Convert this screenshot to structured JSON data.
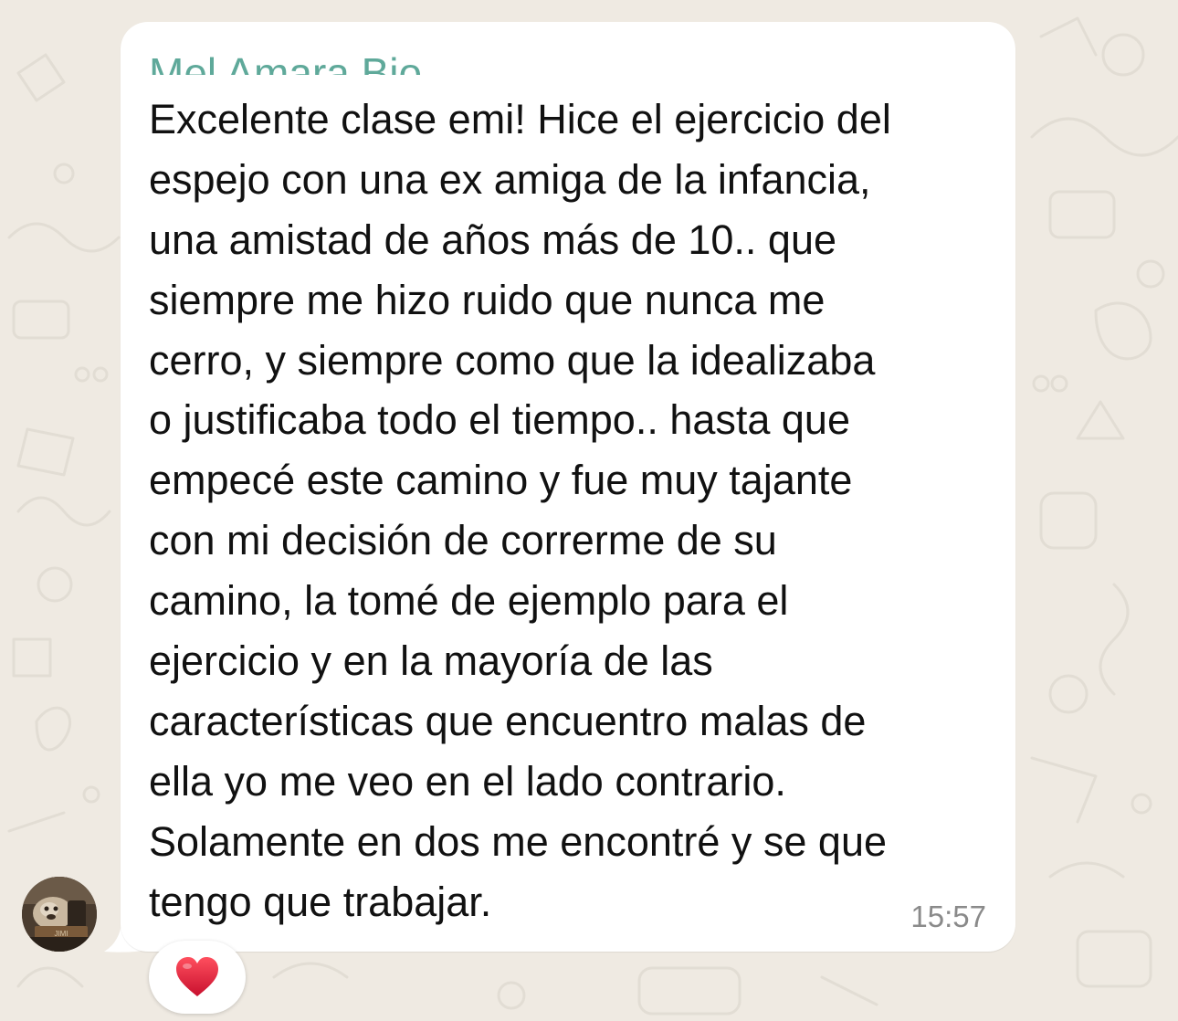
{
  "chat": {
    "background_color": "#efeae2",
    "message": {
      "sender_name": "Mel Amara Bio",
      "sender_color": "#5fa99a",
      "lines": [
        "Excelente clase emi! Hice el ejercicio del",
        "espejo con una ex amiga de la infancia,",
        "una amistad de años más de 10.. que",
        "siempre me hizo ruido que nunca me",
        "cerro, y siempre como que la idealizaba",
        "o justificaba todo el tiempo.. hasta que",
        "empecé este camino y fue muy tajante",
        "con mi decisión de correrme de su",
        "camino, la tomé de ejemplo para el",
        "ejercicio y en la mayoría de las",
        "características que encuentro malas de",
        "ella yo me veo en el lado contrario.",
        "Solamente en dos me encontré y se que",
        "tengo que trabajar."
      ],
      "timestamp": "15:57",
      "reaction": {
        "emoji": "❤️",
        "icon": "red-heart-icon"
      },
      "avatar": {
        "icon": "avatar-photo",
        "caption": "JIMI"
      }
    }
  }
}
